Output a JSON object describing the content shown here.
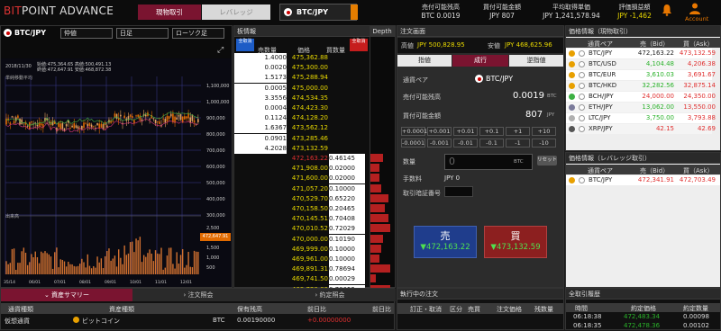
{
  "app": {
    "logo_bit": "BIT",
    "logo_rest": "POINT ADVANCE"
  },
  "header": {
    "tabs": [
      "現物取引",
      "レバレッジ"
    ],
    "pair": "BTC/JPY",
    "stats": [
      {
        "label": "売付可能残高",
        "value": "BTC 0.0019"
      },
      {
        "label": "買付可能金額",
        "value": "JPY 807"
      },
      {
        "label": "平均取得単価",
        "value": "JPY 1,241,578.94"
      },
      {
        "label": "評価損益額",
        "value": "JPY -1,462"
      }
    ],
    "account": "Account"
  },
  "chart": {
    "pair": "BTC/JPY",
    "type": "仲値",
    "interval": "日足",
    "style": "ローソク足",
    "info_date": "2018/11/30",
    "info": [
      [
        "始値",
        ":475,364.65",
        "高値",
        ":500,491.13"
      ],
      [
        "終値",
        ":472,647.91",
        "安値",
        ":468,872.38"
      ]
    ],
    "price_labels": [
      "1,100,000",
      "1,000,000",
      "900,000",
      "800,000",
      "700,000",
      "600,000",
      "500,000",
      "400,000",
      "300,000"
    ],
    "current_price": "472,647.91",
    "vol_labels": [
      "2,500",
      "2,000",
      "1,500",
      "1,000",
      "500"
    ],
    "vol_legend": "出来高",
    "date_labels": [
      "35/14",
      "06/01",
      "07/01",
      "08/01",
      "09/01",
      "10/01",
      "11/01",
      "12/01"
    ],
    "mid_legend": "出来高",
    "top_legend": "単純移動平均"
  },
  "orderbook": {
    "title": "板情報",
    "depth_label": "Depth",
    "buttons": [
      "全取消",
      "全取消"
    ],
    "headers": [
      "売数量",
      "価格",
      "買数量"
    ],
    "asks": [
      [
        "1.4000",
        "475,362.88"
      ],
      [
        "0.0020",
        "475,300.00"
      ],
      [
        "1.5173",
        "475,288.94"
      ],
      [
        "0.0005",
        "475,000.00"
      ],
      [
        "3.3556",
        "474,534.35"
      ],
      [
        "0.0004",
        "474,423.30"
      ],
      [
        "0.1124",
        "474,128.20"
      ],
      [
        "1.6367",
        "473,562.12"
      ],
      [
        "0.0901",
        "473,285.46"
      ],
      [
        "4.2028",
        "473,132.59"
      ]
    ],
    "bids": [
      [
        "472,163.22",
        "0.46145"
      ],
      [
        "471,908.00",
        "0.02000"
      ],
      [
        "471,600.00",
        "0.02000"
      ],
      [
        "471,057.20",
        "0.10000"
      ],
      [
        "470,529.70",
        "0.65220"
      ],
      [
        "470,158.50",
        "0.20465"
      ],
      [
        "470,145.51",
        "0.70408"
      ],
      [
        "470,010.52",
        "0.72029"
      ],
      [
        "470,000.00",
        "0.10190"
      ],
      [
        "469,999.00",
        "0.10000"
      ],
      [
        "469,961.00",
        "0.10000"
      ],
      [
        "469,891.31",
        "0.78694"
      ],
      [
        "469,741.50",
        "0.00029"
      ],
      [
        "469,720.00",
        "0.78055"
      ],
      [
        "469,586.50",
        "0.00063"
      ]
    ]
  },
  "order": {
    "title": "注文画面",
    "high_label": "高値",
    "high": "JPY 500,828.95",
    "low_label": "安値",
    "low": "JPY 468,625.96",
    "tabs": [
      "指値",
      "成行",
      "逆指値"
    ],
    "pair_label": "通貨ペア",
    "pair": "BTC/JPY",
    "sell_avail_label": "売付可能残高",
    "sell_avail": "0.0019",
    "sell_unit": "BTC",
    "buy_avail_label": "買付可能金額",
    "buy_avail": "807",
    "buy_unit": "JPY",
    "steps_row1": [
      "+0.0001",
      "+0.001",
      "+0.01",
      "+0.1",
      "+1",
      "+10"
    ],
    "steps_row2": [
      "-0.0001",
      "-0.001",
      "-0.01",
      "-0.1",
      "-1",
      "-10"
    ],
    "qty_label": "数量",
    "qty_value": "0",
    "qty_unit": "BTC",
    "reset": "リセット",
    "fee_label": "手数料",
    "fee": "JPY 0",
    "pin_label": "取引暗証番号",
    "sell_label": "売",
    "sell_price": "472,163.22",
    "buy_label": "買",
    "buy_price": "473,132.59"
  },
  "prices": {
    "title": "価格情報（現物取引）",
    "headers": [
      "通貨ペア",
      "売（Bid）",
      "買（Ask）"
    ],
    "rows": [
      {
        "pair": "BTC/JPY",
        "bid": "472,163.22",
        "ask": "473,132.59",
        "c": "#ddd"
      },
      {
        "pair": "BTC/USD",
        "bid": "4,104.48",
        "ask": "4,206.38",
        "c": "#2ab22a"
      },
      {
        "pair": "BTC/EUR",
        "bid": "3,610.03",
        "ask": "3,691.67",
        "c": "#2ab22a"
      },
      {
        "pair": "BTC/HKD",
        "bid": "32,282.56",
        "ask": "32,875.14",
        "c": "#2ab22a"
      },
      {
        "pair": "BCH/JPY",
        "bid": "24,000.00",
        "ask": "24,350.00",
        "c": "#e03030"
      },
      {
        "pair": "ETH/JPY",
        "bid": "13,062.00",
        "ask": "13,550.00",
        "c": "#2ab22a"
      },
      {
        "pair": "LTC/JPY",
        "bid": "3,750.00",
        "ask": "3,793.88",
        "c": "#2ab22a"
      },
      {
        "pair": "XRP/JPY",
        "bid": "42.15",
        "ask": "42.69",
        "c": "#e03030"
      }
    ]
  },
  "lev_prices": {
    "title": "価格情報（レバレッジ取引）",
    "headers": [
      "通貨ペア",
      "売（Bid）",
      "買（Ask）"
    ],
    "rows": [
      {
        "pair": "BTC/JPY",
        "bid": "472,341.91",
        "ask": "472,703.49"
      }
    ]
  },
  "assets": {
    "tabs": [
      "資産サマリー",
      "注文照会",
      "約定照会"
    ],
    "headers": [
      "通貨種類",
      "資産種類",
      "保有残高",
      "前日比",
      "前日比"
    ],
    "row": [
      "仮想通貨",
      "ビットコイン",
      "BTC",
      "0.00190000",
      "+0.00000000"
    ]
  },
  "active_orders": {
    "title": "執行中の注文",
    "headers": [
      "訂正・取消",
      "区分",
      "売買",
      "注文価格",
      "残数量"
    ]
  },
  "trade_history": {
    "title": "全取引履歴",
    "headers": [
      "時間",
      "約定価格",
      "約定数量"
    ],
    "rows": [
      [
        "06:18:38",
        "472,483.34",
        "0.00098"
      ],
      [
        "06:18:35",
        "472,478.36",
        "0.00102"
      ]
    ]
  },
  "colors": {
    "accent": "#8e1a3a",
    "sell": "#1f3d8c",
    "buy": "#8c1f1f",
    "up": "#2ab22a",
    "down": "#e03030"
  }
}
